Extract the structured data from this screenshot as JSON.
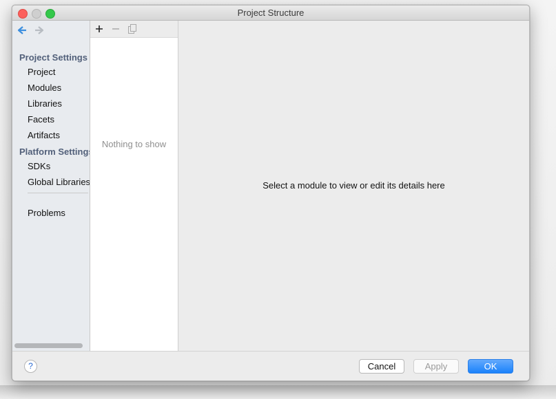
{
  "window": {
    "title": "Project Structure"
  },
  "colors": {
    "accent": "#1a82fb",
    "section_heading": "#52607a"
  },
  "sidebar": {
    "nav": {
      "back_icon": "arrow-left-icon",
      "forward_icon": "arrow-right-icon"
    },
    "project_settings_heading": "Project Settings",
    "project_items": [
      "Project",
      "Modules",
      "Libraries",
      "Facets",
      "Artifacts"
    ],
    "platform_settings_heading": "Platform Settings",
    "platform_items": [
      "SDKs",
      "Global Libraries"
    ],
    "other_items": [
      "Problems"
    ]
  },
  "list": {
    "toolbar": {
      "add_label": "+",
      "remove_label": "−",
      "copy_icon": "copy-icon"
    },
    "empty_text": "Nothing to show"
  },
  "detail": {
    "message": "Select a module to view or edit its details here"
  },
  "footer": {
    "help_label": "?",
    "cancel_label": "Cancel",
    "apply_label": "Apply",
    "ok_label": "OK"
  }
}
